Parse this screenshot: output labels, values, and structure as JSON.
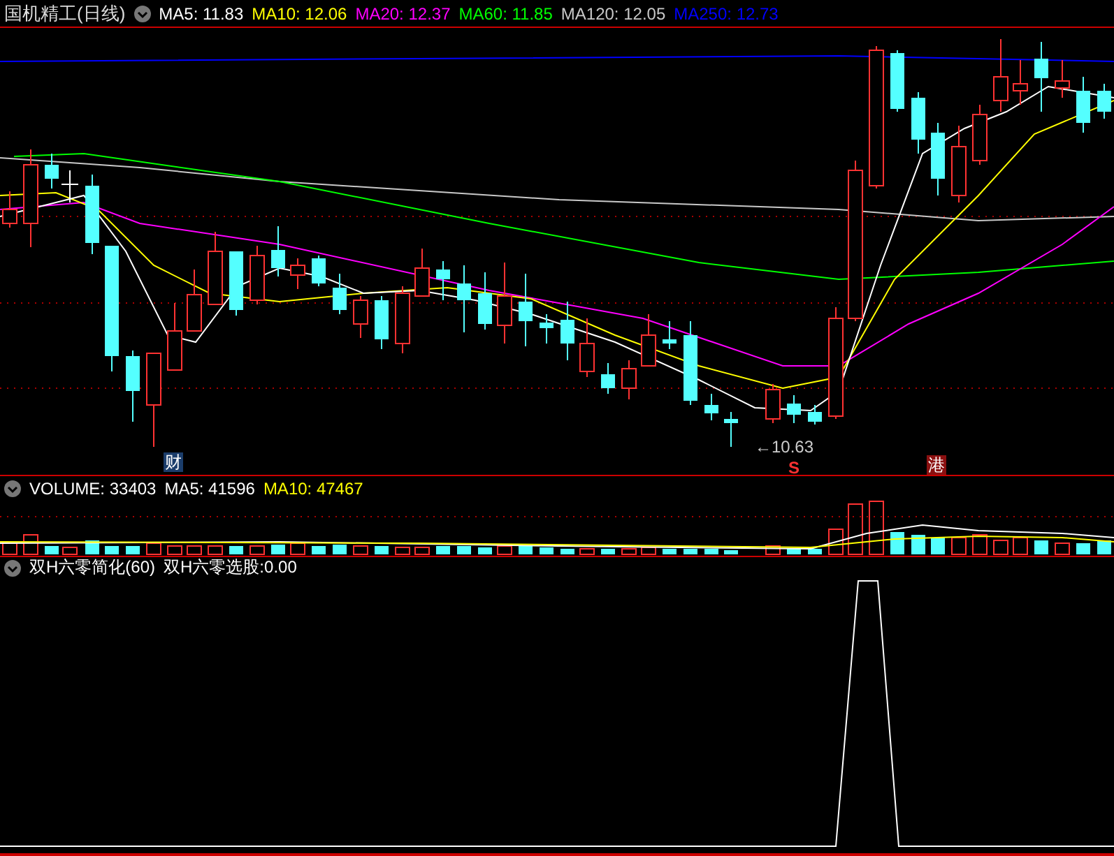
{
  "main": {
    "title": "国机精工(日线)",
    "indicators": [
      {
        "label": "MA5:",
        "value": "11.83",
        "color": "#ffffff"
      },
      {
        "label": "MA10:",
        "value": "12.06",
        "color": "#ffff00"
      },
      {
        "label": "MA20:",
        "value": "12.37",
        "color": "#ff00ff"
      },
      {
        "label": "MA60:",
        "value": "11.85",
        "color": "#00ff00"
      },
      {
        "label": "MA120:",
        "value": "12.05",
        "color": "#c8c8c8"
      },
      {
        "label": "MA250:",
        "value": "12.73",
        "color": "#0000ff"
      }
    ],
    "markers": [
      {
        "text": "财",
        "kind": "news"
      },
      {
        "text": "S",
        "kind": "signal"
      },
      {
        "text": "港",
        "kind": "flag"
      }
    ],
    "low_label": "←10.63"
  },
  "volume": {
    "indicators": [
      {
        "label": "VOLUME:",
        "value": "33403",
        "color": "#ffffff"
      },
      {
        "label": "MA5:",
        "value": "41596",
        "color": "#ffffff"
      },
      {
        "label": "MA10:",
        "value": "47467",
        "color": "#ffff00"
      }
    ]
  },
  "sub": {
    "indicators": [
      {
        "label": "双H六零简化(60)",
        "color": "#ffffff"
      },
      {
        "label": "双H六零选股:",
        "value": "0.00",
        "color": "#ffffff"
      }
    ]
  }
}
